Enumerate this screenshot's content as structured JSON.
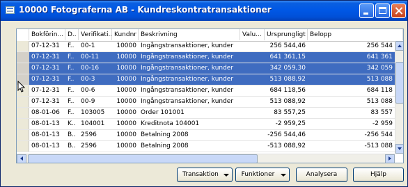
{
  "window": {
    "title": "10000 Fotograferna AB - Kundreskontratransaktioner",
    "icon": "form-icon"
  },
  "table": {
    "columns": [
      "Bokförin...",
      "D..",
      "Verifikati...",
      "Kundnr",
      "Beskrivning",
      "Valu...",
      "Ursprungligt ...",
      "Belopp"
    ],
    "rows": [
      {
        "date": "07-12-31",
        "d": "F..",
        "ver": "00-1",
        "kund": "10000",
        "desc": "Ingångstransaktioner, kunder",
        "valu": "",
        "urspr": "256 544,46",
        "belopp": "256 544",
        "selected": false
      },
      {
        "date": "07-12-31",
        "d": "F..",
        "ver": "00-11",
        "kund": "10000",
        "desc": "Ingångstransaktioner, kunder",
        "valu": "",
        "urspr": "641 361,15",
        "belopp": "641 361",
        "selected": true
      },
      {
        "date": "07-12-31",
        "d": "F..",
        "ver": "00-16",
        "kund": "10000",
        "desc": "Ingångstransaktioner, kunder",
        "valu": "",
        "urspr": "342 059,30",
        "belopp": "342 059",
        "selected": true
      },
      {
        "date": "07-12-31",
        "d": "F..",
        "ver": "00-3",
        "kund": "10000",
        "desc": "Ingångstransaktioner, kunder",
        "valu": "",
        "urspr": "513 088,92",
        "belopp": "513 088",
        "selected": true
      },
      {
        "date": "07-12-31",
        "d": "F..",
        "ver": "00-6",
        "kund": "10000",
        "desc": "Ingångstransaktioner, kunder",
        "valu": "",
        "urspr": "684 118,56",
        "belopp": "684 118",
        "selected": false
      },
      {
        "date": "07-12-31",
        "d": "F..",
        "ver": "00-9",
        "kund": "10000",
        "desc": "Ingångstransaktioner, kunder",
        "valu": "",
        "urspr": "513 088,92",
        "belopp": "513 088",
        "selected": false
      },
      {
        "date": "08-01-06",
        "d": "F..",
        "ver": "103005",
        "kund": "10000",
        "desc": "Order 101001",
        "valu": "",
        "urspr": "83 557,25",
        "belopp": "83 557",
        "selected": false
      },
      {
        "date": "08-01-13",
        "d": "K..",
        "ver": "104001",
        "kund": "10000",
        "desc": "Kreditnota 104001",
        "valu": "",
        "urspr": "-2 959,25",
        "belopp": "-2 959",
        "selected": false
      },
      {
        "date": "08-01-13",
        "d": "B..",
        "ver": "2596",
        "kund": "10000",
        "desc": "Betalning 2008",
        "valu": "",
        "urspr": "-256 544,46",
        "belopp": "-256 544",
        "selected": false
      },
      {
        "date": "08-01-13",
        "d": "B..",
        "ver": "2596",
        "kund": "10000",
        "desc": "Betalning 2008",
        "valu": "",
        "urspr": "-513 088,92",
        "belopp": "-513 088",
        "selected": false
      }
    ]
  },
  "buttons": {
    "transaktion": "Transaktion",
    "funktioner": "Funktioner",
    "analysera": "Analysera",
    "hjalp": "Hjälp"
  },
  "colors": {
    "titlebar": "#0058e6",
    "selection": "#3f6cc0",
    "face": "#ece9d8"
  }
}
